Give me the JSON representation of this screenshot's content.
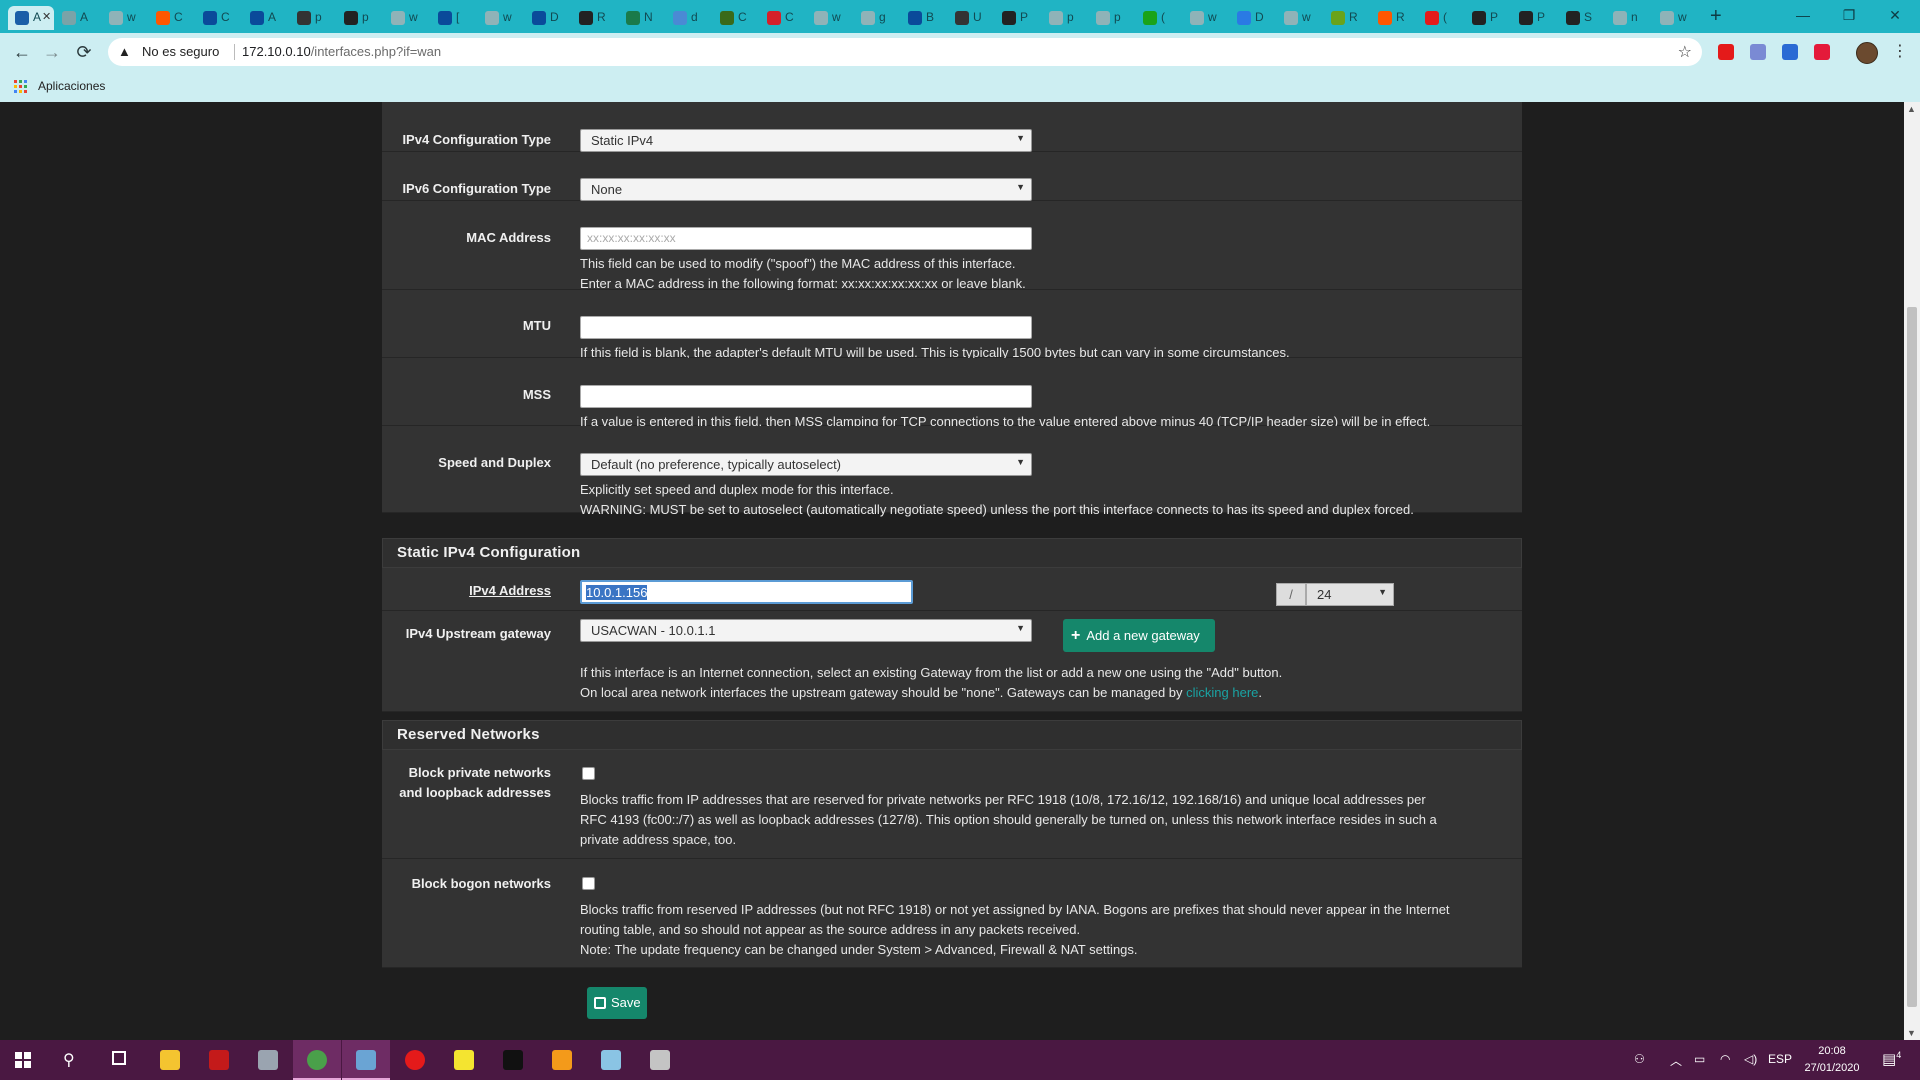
{
  "browser": {
    "tabs": [
      {
        "title": "A",
        "color": "#1b5fa8"
      },
      {
        "title": "A",
        "color": "#7aa3a8"
      },
      {
        "title": "w",
        "color": "#8fb3b8"
      },
      {
        "title": "C",
        "color": "#ff5700"
      },
      {
        "title": "C",
        "color": "#0a4a9a"
      },
      {
        "title": "A",
        "color": "#0a4a9a"
      },
      {
        "title": "p",
        "color": "#333333"
      },
      {
        "title": "p",
        "color": "#222222"
      },
      {
        "title": "w",
        "color": "#8fb3b8"
      },
      {
        "title": "[",
        "color": "#0a4a9a"
      },
      {
        "title": "w",
        "color": "#8fb3b8"
      },
      {
        "title": "D",
        "color": "#0a4a9a"
      },
      {
        "title": "R",
        "color": "#222222"
      },
      {
        "title": "N",
        "color": "#1a7a4a"
      },
      {
        "title": "d",
        "color": "#4a8ad4"
      },
      {
        "title": "C",
        "color": "#3a6a1a"
      },
      {
        "title": "C",
        "color": "#d4202a"
      },
      {
        "title": "w",
        "color": "#8fb3b8"
      },
      {
        "title": "g",
        "color": "#8fb3b8"
      },
      {
        "title": "B",
        "color": "#0a4a9a"
      },
      {
        "title": "U",
        "color": "#333333"
      },
      {
        "title": "P",
        "color": "#222222"
      },
      {
        "title": "p",
        "color": "#8fb3b8"
      },
      {
        "title": "p",
        "color": "#8fb3b8"
      },
      {
        "title": "(",
        "color": "#1aa31a"
      },
      {
        "title": "w",
        "color": "#8fb3b8"
      },
      {
        "title": "D",
        "color": "#2a7ae4"
      },
      {
        "title": "w",
        "color": "#8fb3b8"
      },
      {
        "title": "R",
        "color": "#6aa31a"
      },
      {
        "title": "R",
        "color": "#ff5700"
      },
      {
        "title": "(",
        "color": "#e41a1a"
      },
      {
        "title": "P",
        "color": "#222222"
      },
      {
        "title": "P",
        "color": "#222222"
      },
      {
        "title": "S",
        "color": "#222222"
      },
      {
        "title": "n",
        "color": "#8fb3b8"
      },
      {
        "title": "w",
        "color": "#8fb3b8"
      }
    ],
    "new_tab": "+",
    "window_controls": {
      "minimize": "—",
      "restore": "❐",
      "close": "✕"
    },
    "nav": {
      "back": "←",
      "forward": "→",
      "reload": "⟳"
    },
    "security_label": "No es seguro",
    "url_host": "172.10.0.10",
    "url_path": "/interfaces.php?if=wan",
    "bookmarks_label": "Aplicaciones",
    "extension_colors": [
      "#e41a1a",
      "#7a8ad4",
      "#2a6ad4",
      "#e41a3a"
    ]
  },
  "form": {
    "ipv4_config_type": {
      "label": "IPv4 Configuration Type",
      "value": "Static IPv4"
    },
    "ipv6_config_type": {
      "label": "IPv6 Configuration Type",
      "value": "None"
    },
    "mac_address": {
      "label": "MAC Address",
      "placeholder": "xx:xx:xx:xx:xx:xx",
      "help_1": "This field can be used to modify (\"spoof\") the MAC address of this interface.",
      "help_2": "Enter a MAC address in the following format: xx:xx:xx:xx:xx:xx or leave blank."
    },
    "mtu": {
      "label": "MTU",
      "help": "If this field is blank, the adapter's default MTU will be used. This is typically 1500 bytes but can vary in some circumstances."
    },
    "mss": {
      "label": "MSS",
      "help": "If a value is entered in this field, then MSS clamping for TCP connections to the value entered above minus 40 (TCP/IP header size) will be in effect."
    },
    "speed_duplex": {
      "label": "Speed and Duplex",
      "value": "Default (no preference, typically autoselect)",
      "help_1": "Explicitly set speed and duplex mode for this interface.",
      "help_2": "WARNING: MUST be set to autoselect (automatically negotiate speed) unless the port this interface connects to has its speed and duplex forced."
    },
    "static_ipv4": {
      "header": "Static IPv4 Configuration",
      "address_label": "IPv4 Address",
      "address_value": "10.0.1.156",
      "slash": "/",
      "cidr": "24",
      "gateway_label": "IPv4 Upstream gateway",
      "gateway_value": "USACWAN - 10.0.1.1",
      "add_gateway": "Add a new gateway",
      "help_1": "If this interface is an Internet connection, select an existing Gateway from the list or add a new one using the \"Add\" button.",
      "help_2": "On local area network interfaces the upstream gateway should be \"none\". Gateways can be managed by ",
      "help_link": "clicking here",
      "help_end": "."
    },
    "reserved": {
      "header": "Reserved Networks",
      "block_private_label_1": "Block private networks",
      "block_private_label_2": "and loopback addresses",
      "block_private_help_1": "Blocks traffic from IP addresses that are reserved for private networks per RFC 1918 (10/8, 172.16/12, 192.168/16) and unique local addresses per",
      "block_private_help_2": "RFC 4193 (fc00::/7) as well as loopback addresses (127/8). This option should generally be turned on, unless this network interface resides in such a",
      "block_private_help_3": "private address space, too.",
      "block_bogon_label": "Block bogon networks",
      "block_bogon_help_1": "Blocks traffic from reserved IP addresses (but not RFC 1918) or not yet assigned by IANA. Bogons are prefixes that should never appear in the Internet",
      "block_bogon_help_2": "routing table, and so should not appear as the source address in any packets received.",
      "block_bogon_help_3": "Note: The update frequency can be changed under System > Advanced, Firewall & NAT settings."
    },
    "save_label": "Save"
  },
  "taskbar": {
    "apps": [
      {
        "name": "file-explorer",
        "color": "#f4c430"
      },
      {
        "name": "red-app",
        "color": "#c41a1a"
      },
      {
        "name": "network-app",
        "color": "#9aa4b0"
      },
      {
        "name": "chrome",
        "color": "#4aa04a"
      },
      {
        "name": "virtualbox",
        "color": "#6aa4d4"
      },
      {
        "name": "opera",
        "color": "#e41a1a"
      },
      {
        "name": "sticky-notes",
        "color": "#f4e430"
      },
      {
        "name": "terminal",
        "color": "#111111"
      },
      {
        "name": "sublime",
        "color": "#f49a1a"
      },
      {
        "name": "app-blue",
        "color": "#8ac4e4"
      },
      {
        "name": "app-gear",
        "color": "#c4c4c4"
      }
    ],
    "language": "ESP",
    "time": "20:08",
    "date": "27/01/2020",
    "notifications": "4"
  }
}
